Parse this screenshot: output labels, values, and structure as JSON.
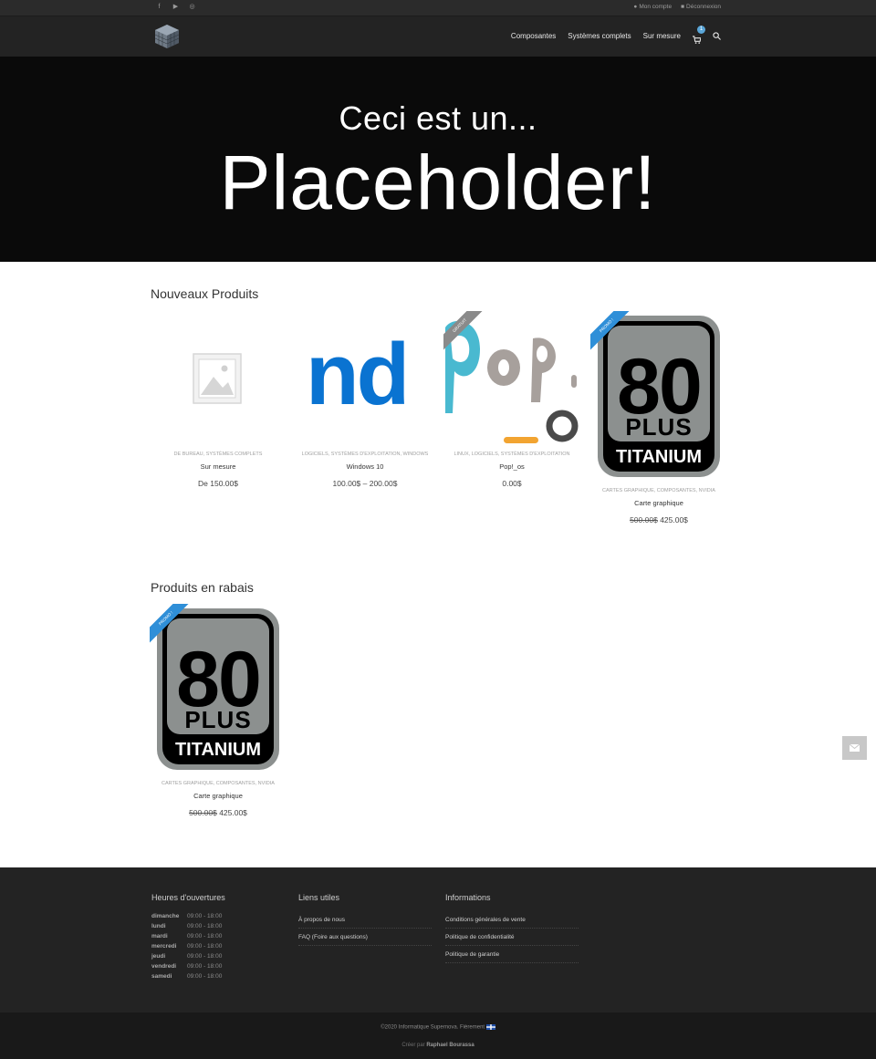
{
  "topbar": {
    "social": [
      "facebook-icon",
      "youtube-icon",
      "instagram-icon"
    ],
    "account": {
      "my_account": "Mon compte",
      "logout": "Déconnexion"
    }
  },
  "nav": {
    "items": [
      "Composantes",
      "Systèmes complets",
      "Sur mesure"
    ],
    "cart_count": "1"
  },
  "hero": {
    "line1": "Ceci est un...",
    "line2": "Placeholder!"
  },
  "new_products": {
    "title": "Nouveaux Produits",
    "items": [
      {
        "cats": "DE BUREAU, SYSTÈMES COMPLETS",
        "name": "Sur mesure",
        "price": "De 150.00$",
        "image": "placeholder-image-icon"
      },
      {
        "cats": "LOGICIELS, SYSTÈMES D'EXPLOITATION, WINDOWS",
        "name": "Windows 10",
        "price": "100.00$ – 200.00$",
        "image": "windows-logo-crop",
        "image_text": "nd"
      },
      {
        "cats": "LINUX, LOGICIELS, SYSTÈMES D'EXPLOITATION",
        "name": "Pop!_os",
        "price": "0.00$",
        "image": "popos-logo",
        "badge": "GRATUIT"
      },
      {
        "cats": "CARTES GRAPHIQUE, COMPOSANTES, NVIDIA",
        "name": "Carte graphique",
        "old_price": "500.00$",
        "price": "425.00$",
        "image": "80plus-titanium-logo",
        "badge": "PROMO !"
      }
    ]
  },
  "sale_products": {
    "title": "Produits en rabais",
    "items": [
      {
        "cats": "CARTES GRAPHIQUE, COMPOSANTES, NVIDIA",
        "name": "Carte graphique",
        "old_price": "500.00$",
        "price": "425.00$",
        "image": "80plus-titanium-logo",
        "badge": "PROMO !"
      }
    ]
  },
  "footer": {
    "hours": {
      "title": "Heures d'ouvertures",
      "rows": [
        {
          "day": "dimanche",
          "time": "09:00 - 18:00"
        },
        {
          "day": "lundi",
          "time": "09:00 - 18:00"
        },
        {
          "day": "mardi",
          "time": "09:00 - 18:00"
        },
        {
          "day": "mercredi",
          "time": "09:00 - 18:00"
        },
        {
          "day": "jeudi",
          "time": "09:00 - 18:00"
        },
        {
          "day": "vendredi",
          "time": "09:00 - 18:00"
        },
        {
          "day": "samedi",
          "time": "09:00 - 18:00"
        }
      ]
    },
    "links": {
      "title": "Liens utiles",
      "items": [
        "À propos de nous",
        "FAQ (Foire aux questions)"
      ]
    },
    "info": {
      "title": "Informations",
      "items": [
        "Conditions générales de vente",
        "Politique de confidentialité",
        "Politique de garantie"
      ]
    },
    "copyright": "©2020 Informatique Supernova. Fièrement",
    "credit_prefix": "Créer par",
    "credit_name": "Raphael Bourassa"
  },
  "colors": {
    "accent": "#2f8fd8",
    "dark": "#232323",
    "hero": "#0a0a0a"
  }
}
